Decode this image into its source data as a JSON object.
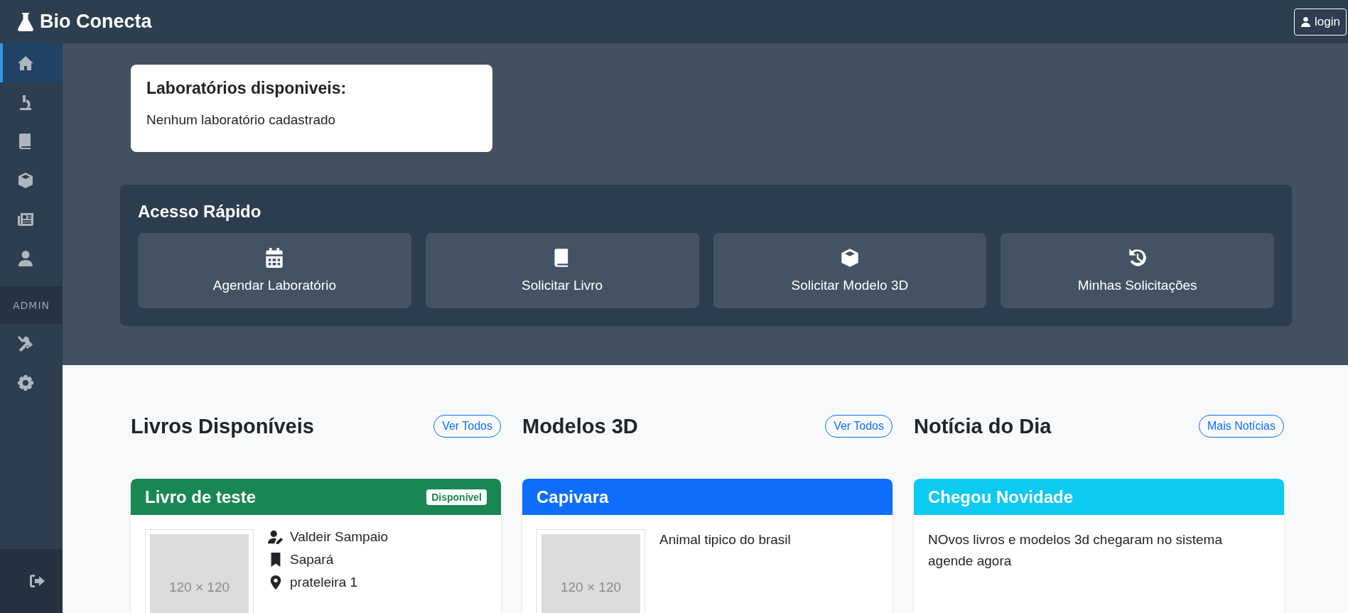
{
  "brand": {
    "title": "Bio Conecta"
  },
  "login_button": {
    "label": "login"
  },
  "sidebar": {
    "items": [
      {
        "kind": "home",
        "selected": true
      },
      {
        "kind": "microscope",
        "selected": false
      },
      {
        "kind": "book",
        "selected": false
      },
      {
        "kind": "cube",
        "selected": false
      },
      {
        "kind": "newspaper",
        "selected": false
      },
      {
        "kind": "user",
        "selected": false
      }
    ],
    "section_label": "ADMIN",
    "admin_items": [
      {
        "kind": "tools",
        "selected": false
      },
      {
        "kind": "gear",
        "selected": false
      }
    ],
    "footer_item": {
      "kind": "logout"
    }
  },
  "labs_card": {
    "title": "Laboratórios disponiveis:",
    "message": "Nenhum laboratório cadastrado"
  },
  "quick_access": {
    "title": "Acesso Rápido",
    "items": [
      {
        "kind": "calendar",
        "label": "Agendar Laboratório"
      },
      {
        "kind": "book",
        "label": "Solicitar Livro"
      },
      {
        "kind": "cube",
        "label": "Solicitar Modelo 3D"
      },
      {
        "kind": "history",
        "label": "Minhas Solicitações"
      }
    ]
  },
  "sections": [
    {
      "title": "Livros Disponíveis",
      "button": "Ver Todos",
      "card": {
        "color": "#198754",
        "title": "Livro de teste",
        "badge": "Disponível",
        "image": "120 × 120",
        "details": [
          {
            "kind": "author",
            "text": "Valdeir Sampaio"
          },
          {
            "kind": "bookmark",
            "text": "Sapará"
          },
          {
            "kind": "location",
            "text": "prateleira 1"
          }
        ]
      }
    },
    {
      "title": "Modelos 3D",
      "button": "Ver Todos",
      "card": {
        "color": "#0d6efd",
        "title": "Capivara",
        "image": "120 × 120",
        "description": "Animal tipico do brasil"
      }
    },
    {
      "title": "Notícia do Dia",
      "button": "Mais Notícias",
      "card": {
        "color": "#0dcaf0",
        "title": "Chegou Novidade",
        "description": "NOvos livros e modelos 3d chegaram no sistema agende agora"
      }
    }
  ]
}
